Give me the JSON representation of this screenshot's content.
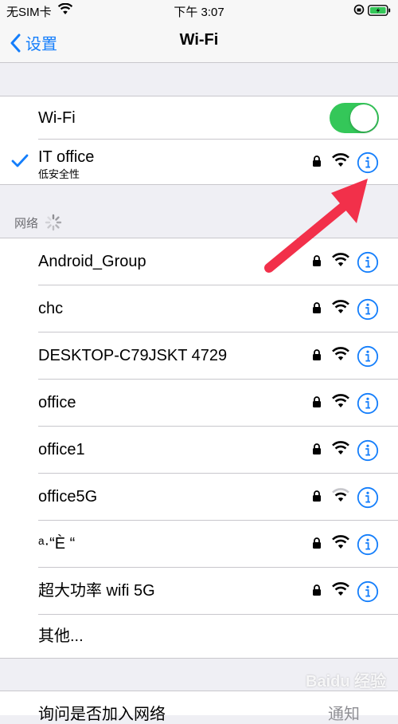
{
  "status_bar": {
    "carrier": "无SIM卡",
    "time": "下午 3:07"
  },
  "nav": {
    "back_label": "设置",
    "title": "Wi-Fi"
  },
  "wifi_toggle": {
    "label": "Wi-Fi",
    "on": true
  },
  "current_network": {
    "name": "IT office",
    "subtitle": "低安全性"
  },
  "networks_header": "网络",
  "networks": [
    {
      "name": "Android_Group",
      "signal": "full"
    },
    {
      "name": "chc",
      "signal": "full"
    },
    {
      "name": "DESKTOP-C79JSKT 4729",
      "signal": "full"
    },
    {
      "name": "office",
      "signal": "full"
    },
    {
      "name": "office1",
      "signal": "full"
    },
    {
      "name": "office5G",
      "signal": "weak"
    },
    {
      "name": "ᵃ·“È “",
      "signal": "full"
    },
    {
      "name": "超大功率 wifi 5G",
      "signal": "full"
    }
  ],
  "other_label": "其他...",
  "ask_join": {
    "label": "询问是否加入网络",
    "value": "通知"
  },
  "watermark": "Baidu 经验",
  "colors": {
    "accent": "#147efb",
    "toggle_on": "#34c759",
    "arrow": "#f2304a"
  }
}
